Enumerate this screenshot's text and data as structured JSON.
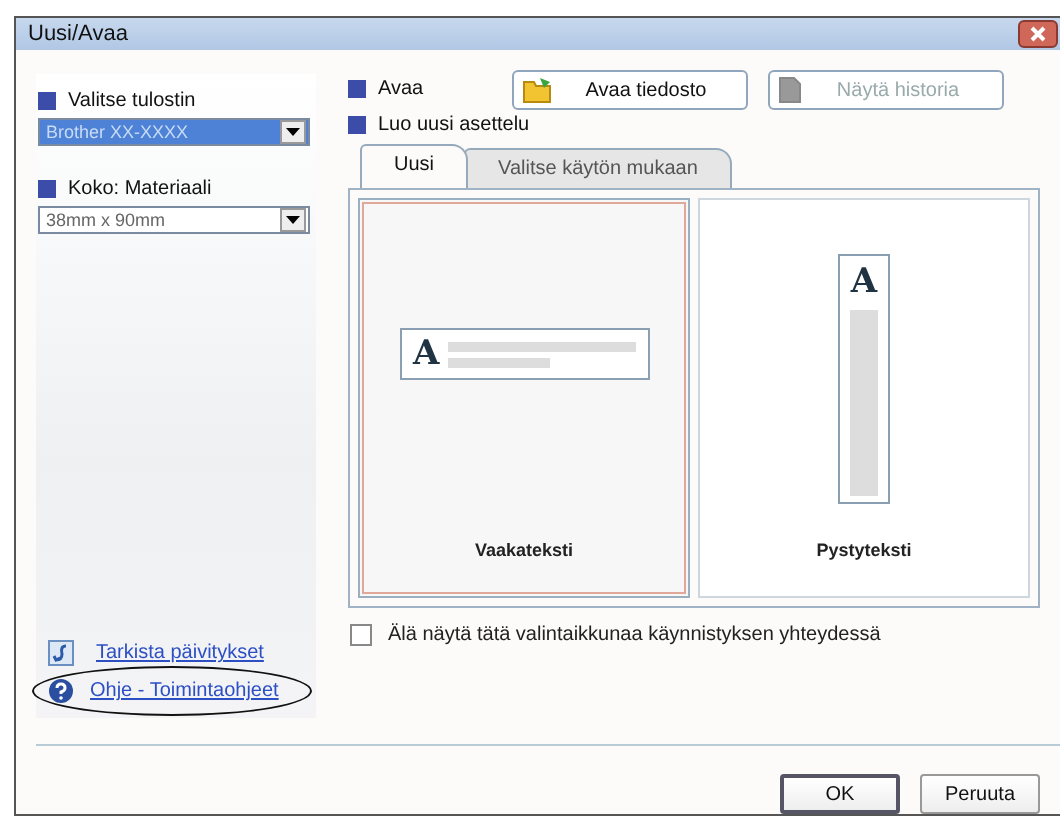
{
  "window": {
    "title": "Uusi/Avaa"
  },
  "sidebar": {
    "printer": {
      "label": "Valitse tulostin",
      "value": "Brother XX-XXXX",
      "selected": true
    },
    "size": {
      "label": "Koko: Materiaali",
      "value": "38mm x 90mm",
      "selected": false
    },
    "links": [
      {
        "kind": "update",
        "label": "Tarkista päivitykset",
        "circled": false
      },
      {
        "kind": "help",
        "label": "Ohje - Toimintaohjeet",
        "circled": true
      }
    ]
  },
  "open": {
    "label": "Avaa",
    "buttons": [
      {
        "kind": "folder",
        "label": "Avaa tiedosto",
        "disabled": false
      },
      {
        "kind": "history",
        "label": "Näytä historia",
        "disabled": true
      }
    ]
  },
  "new_layout": {
    "label": "Luo uusi asettelu",
    "tabs": [
      {
        "label": "Uusi",
        "selected": true
      },
      {
        "label": "Valitse käytön mukaan",
        "selected": false
      }
    ],
    "layouts": [
      {
        "kind": "horizontal",
        "preview_text": "A",
        "label": "Vaakateksti",
        "selected": true
      },
      {
        "kind": "vertical",
        "preview_text": "A",
        "label": "Pystyteksti",
        "selected": false
      }
    ]
  },
  "startup_checkbox": {
    "label": "Älä näytä tätä valintaikkunaa käynnistyksen yhteydessä",
    "checked": false
  },
  "buttons": [
    {
      "label": "OK",
      "default": true
    },
    {
      "label": "Peruuta",
      "default": false
    }
  ]
}
